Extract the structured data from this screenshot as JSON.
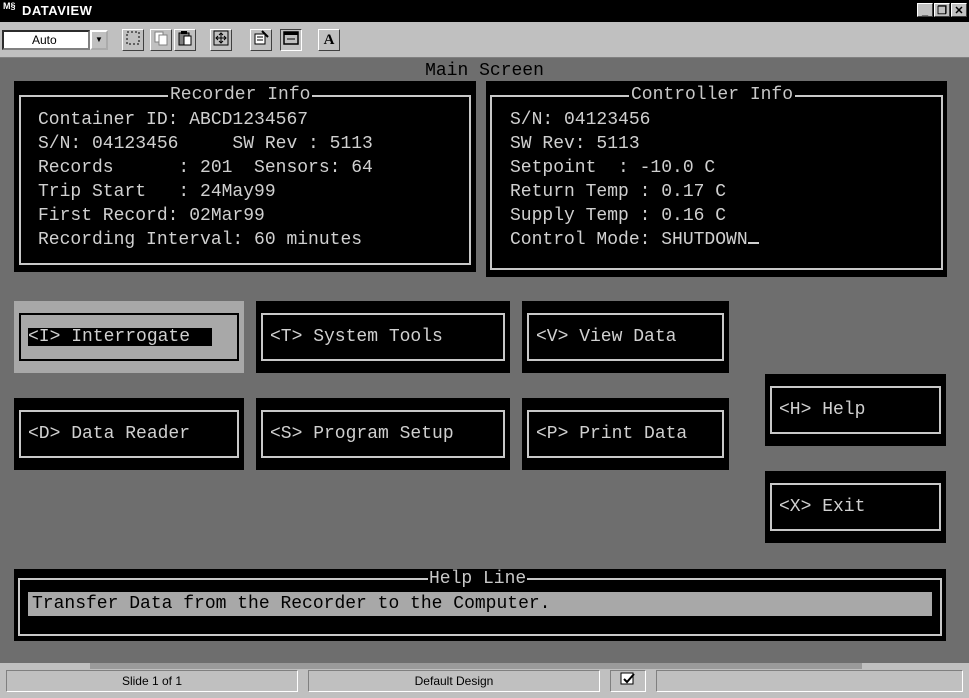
{
  "window": {
    "title": "DATAVIEW",
    "app_icon_text": "M§",
    "minimize": "_",
    "restore": "❐",
    "close": "✕"
  },
  "toolbar": {
    "zoom_value": "Auto",
    "text_tool_label": "A"
  },
  "screen": {
    "title": "Main Screen"
  },
  "recorder": {
    "legend": "Recorder Info",
    "container_id": "Container ID: ABCD1234567",
    "sn_rev": "S/N: 04123456     SW Rev : 5113",
    "records": "Records      : 201  Sensors: 64",
    "trip_start": "Trip Start   : 24May99",
    "first_record": "First Record: 02Mar99",
    "interval": "Recording Interval: 60 minutes"
  },
  "controller": {
    "legend": "Controller Info",
    "sn": "S/N: 04123456",
    "sw_rev": "SW Rev: 5113",
    "setpoint": "Setpoint  : -10.0 C",
    "return_temp": "Return Temp : 0.17 C",
    "supply_temp": "Supply Temp : 0.16 C",
    "control_mode": "Control Mode: SHUTDOWN"
  },
  "buttons": {
    "interrogate": "<I> Interrogate",
    "system_tools": "<T> System Tools",
    "view_data": "<V> View Data",
    "data_reader": "<D> Data Reader",
    "program_setup": "<S> Program Setup",
    "print_data": "<P> Print Data",
    "help": "<H> Help",
    "exit": "<X> Exit"
  },
  "help_line": {
    "legend": "Help Line",
    "text": "Transfer Data from the Recorder to the Computer."
  },
  "status": {
    "slide": "Slide 1 of 1",
    "design": "Default Design"
  }
}
